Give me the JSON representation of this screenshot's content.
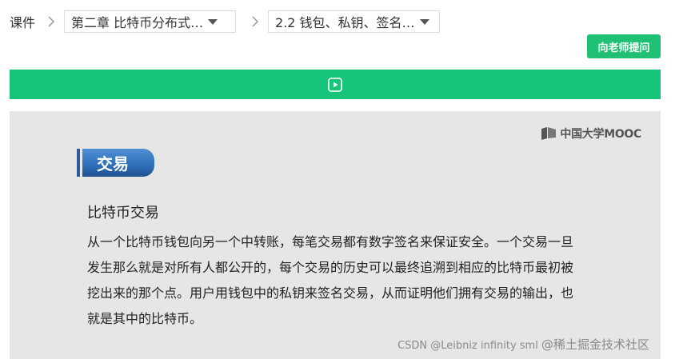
{
  "breadcrumb": {
    "root": "课件",
    "chapter": "第二章 比特币分布式…",
    "lesson": "2.2 钱包、私钥、签名…"
  },
  "actions": {
    "ask_teacher": "向老师提问"
  },
  "colors": {
    "accent": "#16c57a",
    "tag_blue": "#2f6fb8",
    "slide_bg": "#e6e6e6"
  },
  "slide": {
    "logo_text": "中国大学MOOC",
    "section_tag": "交易",
    "title": "比特币交易",
    "body": "从一个比特币钱包向另一个中转账，每笔交易都有数字签名来保证安全。一个交易一旦发生那么就是对所有人都公开的，每个交易的历史可以最终追溯到相应的比特币最初被挖出来的那个点。用户用钱包中的私钥来签名交易，从而证明他们拥有交易的输出，也就是其中的比特币。"
  },
  "watermark": {
    "line1": "@稀土掘金技术社区",
    "line2": "CSDN @Leibniz infinity sml"
  }
}
